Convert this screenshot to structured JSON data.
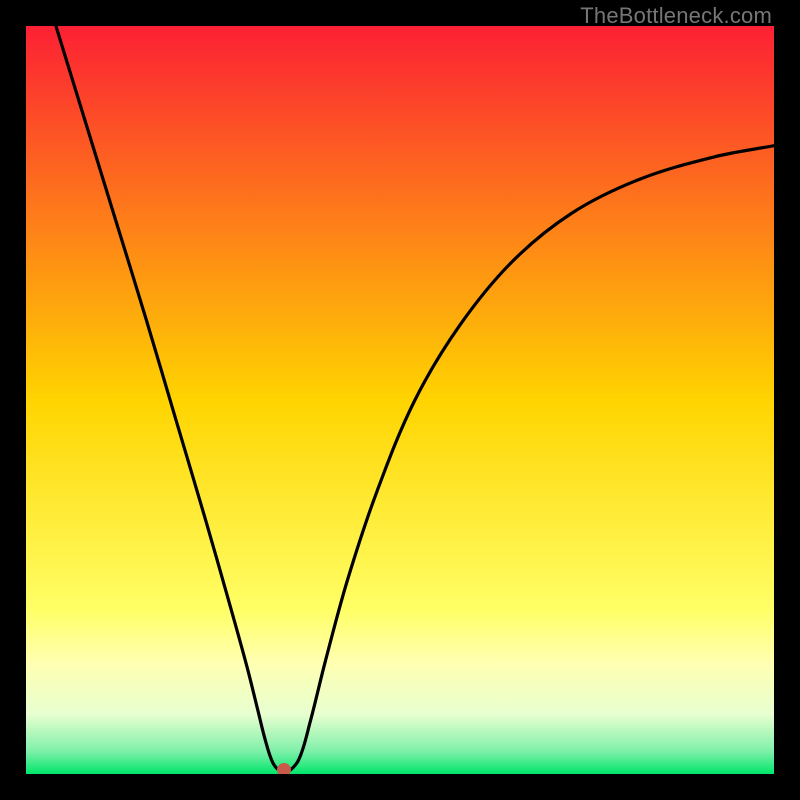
{
  "watermark": "TheBottleneck.com",
  "chart_data": {
    "type": "line",
    "title": "",
    "xlabel": "",
    "ylabel": "",
    "xlim": [
      0,
      100
    ],
    "ylim": [
      0,
      100
    ],
    "gradient_stops": [
      {
        "offset": 0.0,
        "color": "#fc2034"
      },
      {
        "offset": 0.5,
        "color": "#ffd400"
      },
      {
        "offset": 0.78,
        "color": "#ffff66"
      },
      {
        "offset": 0.85,
        "color": "#ffffb0"
      },
      {
        "offset": 0.92,
        "color": "#e8ffd0"
      },
      {
        "offset": 0.97,
        "color": "#7df0a8"
      },
      {
        "offset": 1.0,
        "color": "#00e66a"
      }
    ],
    "curve": {
      "x": [
        4.0,
        8.0,
        12.0,
        16.0,
        20.0,
        24.0,
        27.0,
        29.5,
        31.0,
        32.0,
        33.0,
        34.0,
        35.0,
        36.5,
        38.0,
        40.0,
        43.0,
        47.0,
        52.0,
        58.0,
        65.0,
        73.0,
        82.0,
        92.0,
        100.0
      ],
      "y": [
        100.0,
        87.0,
        74.0,
        61.0,
        47.5,
        34.0,
        23.5,
        14.5,
        8.5,
        4.5,
        1.5,
        0.4,
        0.3,
        2.0,
        7.0,
        15.0,
        26.0,
        38.0,
        50.0,
        60.0,
        68.5,
        75.0,
        79.5,
        82.5,
        84.0
      ]
    },
    "marker": {
      "x": 34.5,
      "y": 0.6,
      "color": "#c85a4a"
    }
  }
}
